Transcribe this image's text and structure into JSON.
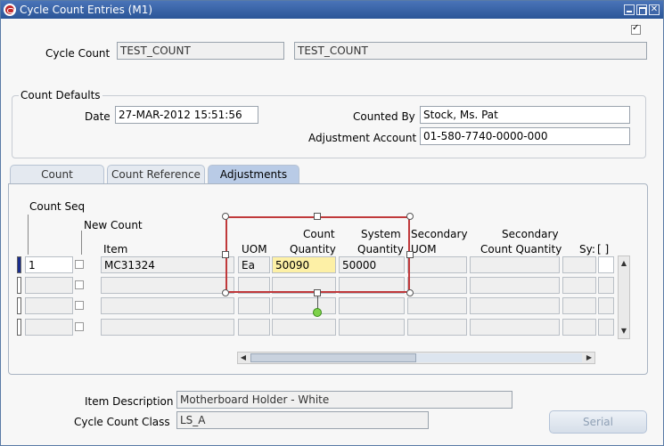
{
  "window": {
    "title": "Cycle Count Entries (M1)",
    "close_glyph": "✕"
  },
  "top": {
    "cycle_count_label": "Cycle Count",
    "cycle_count_value": "TEST_COUNT",
    "cycle_count_desc": "TEST_COUNT"
  },
  "defaults": {
    "group_label": "Count Defaults",
    "date_label": "Date",
    "date_value": "27-MAR-2012 15:51:56",
    "counted_by_label": "Counted By",
    "counted_by_value": "Stock, Ms. Pat",
    "adj_account_label": "Adjustment Account",
    "adj_account_value": "01-580-7740-0000-000"
  },
  "tabs": [
    "Count",
    "Count Reference",
    "Adjustments"
  ],
  "headers": {
    "count_seq": "Count Seq",
    "new_count": "New Count",
    "item": "Item",
    "uom": "UOM",
    "count_qty_1": "Count",
    "count_qty_2": "Quantity",
    "system_qty_1": "System",
    "system_qty_2": "Quantity",
    "sec_uom_1": "Secondary",
    "sec_uom_2": "UOM",
    "sec_count_1": "Secondary",
    "sec_count_2": "Count Quantity",
    "sys_trunc": "Sy:",
    "bracket": "[ ]"
  },
  "rows": [
    {
      "seq": "1",
      "item": "MC31324",
      "uom": "Ea",
      "count_qty": "50090",
      "system_qty": "50000"
    }
  ],
  "footer": {
    "item_desc_label": "Item Description",
    "item_desc_value": "Motherboard Holder - White",
    "class_label": "Cycle Count Class",
    "class_value": "LS_A",
    "serial_button": "Serial"
  }
}
